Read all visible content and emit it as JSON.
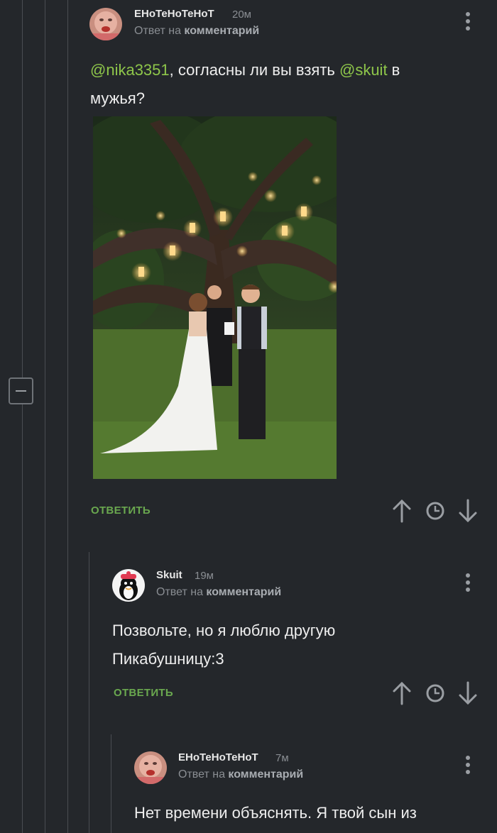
{
  "comments": [
    {
      "author": "ЕНоТеНоТеНоТ",
      "time": "20м",
      "reply_prefix": "Ответ на",
      "reply_link": "комментарий",
      "mention1": "@nika3351",
      "text1": ",  согласны ли вы взять ",
      "mention2": "@skuit",
      "text2": " в",
      "text3": "мужья?",
      "reply_label": "ОТВЕТИТЬ"
    },
    {
      "author": "Skuit",
      "time": "19м",
      "reply_prefix": "Ответ на",
      "reply_link": "комментарий",
      "line1": "Позвольте, но я люблю другую",
      "line2": "Пикабушницу:3",
      "reply_label": "ОТВЕТИТЬ"
    },
    {
      "author": "ЕНоТеНоТеНоТ",
      "time": "7м",
      "reply_prefix": "Ответ на",
      "reply_link": "комментарий",
      "line1": "Нет времени объяснять. Я твой сын из"
    }
  ],
  "colors": {
    "background": "#24272b",
    "mention": "#8ec64a",
    "reply": "#6aa84f",
    "muted": "#8a8e93"
  },
  "icons": [
    "collapse-icon",
    "more-icon",
    "upvote-icon",
    "clock-icon",
    "downvote-icon"
  ]
}
